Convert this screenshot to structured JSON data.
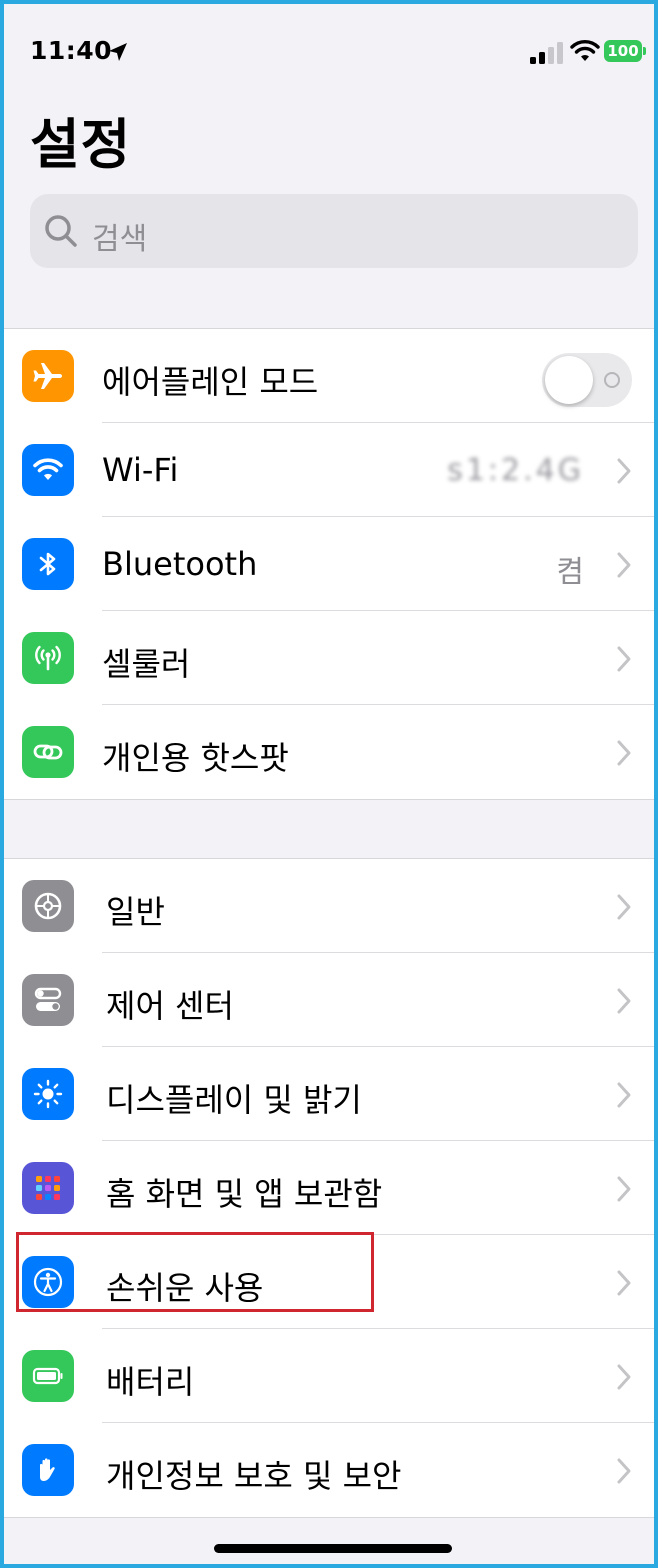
{
  "status_bar": {
    "time": "11:40",
    "battery": "100",
    "icons": [
      "location-arrow-icon",
      "cellular-signal-icon",
      "wifi-icon",
      "battery-icon"
    ]
  },
  "title": "설정",
  "search": {
    "placeholder": "검색"
  },
  "group1": [
    {
      "label": "에어플레인 모드",
      "icon": "airplane-icon",
      "icon_color": "#ff9500",
      "control": "toggle",
      "toggle_on": false
    },
    {
      "label": "Wi-Fi",
      "icon": "wifi-icon",
      "icon_color": "#007aff",
      "value": "s1:2.4G",
      "control": "chevron"
    },
    {
      "label": "Bluetooth",
      "icon": "bluetooth-icon",
      "icon_color": "#007aff",
      "value": "켬",
      "control": "chevron"
    },
    {
      "label": "셀룰러",
      "icon": "antenna-icon",
      "icon_color": "#34c759",
      "control": "chevron"
    },
    {
      "label": "개인용 핫스팟",
      "icon": "link-icon",
      "icon_color": "#34c759",
      "control": "chevron"
    }
  ],
  "group2": [
    {
      "label": "일반",
      "icon": "gear-icon",
      "icon_color": "#8e8e93"
    },
    {
      "label": "제어 센터",
      "icon": "switches-icon",
      "icon_color": "#8e8e93"
    },
    {
      "label": "디스플레이 및 밝기",
      "icon": "sun-icon",
      "icon_color": "#007aff"
    },
    {
      "label": "홈 화면 및 앱 보관함",
      "icon": "app-grid-icon",
      "icon_color": "#5856d6"
    },
    {
      "label": "손쉬운 사용",
      "icon": "accessibility-icon",
      "icon_color": "#007aff",
      "highlighted": true
    },
    {
      "label": "배터리",
      "icon": "battery-icon",
      "icon_color": "#34c759"
    },
    {
      "label": "개인정보 보호 및 보안",
      "icon": "hand-icon",
      "icon_color": "#007aff"
    }
  ],
  "colors": {
    "accent": "#007aff",
    "highlight": "#d0262f",
    "frame": "#2aa8e0"
  }
}
